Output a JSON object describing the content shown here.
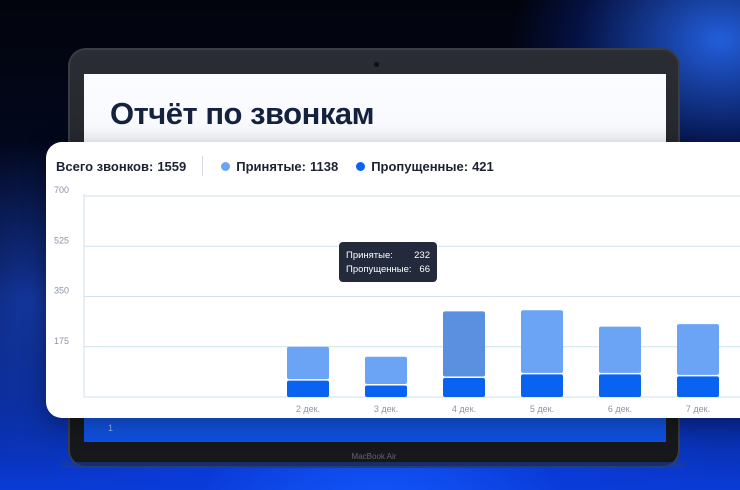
{
  "screen": {
    "title": "Отчёт по звонкам",
    "bottom_tick": "1",
    "device_label": "MacBook Air"
  },
  "summary": {
    "total_label": "Всего звонков:",
    "total_value": "1559",
    "accepted_label": "Принятые:",
    "accepted_value": "1138",
    "missed_label": "Пропущенные:",
    "missed_value": "421"
  },
  "colors": {
    "accepted": "#6ba4f5",
    "accepted_active": "#5b8fe0",
    "missed": "#0a63f0",
    "grid": "#cfe2ee",
    "tick": "#8a93a6"
  },
  "tooltip": {
    "accepted_label": "Принятые:",
    "accepted_value": "232",
    "missed_label": "Пропущенные:",
    "missed_value": "66"
  },
  "chart_data": {
    "type": "bar",
    "stacked": true,
    "title": "",
    "xlabel": "",
    "ylabel": "",
    "ylim": [
      0,
      700
    ],
    "yticks": [
      "700",
      "525",
      "350",
      "175"
    ],
    "categories": [
      "",
      "",
      "2 дек.",
      "3 дек.",
      "4 дек.",
      "5 дек.",
      "6 дек.",
      "7 дек."
    ],
    "series": [
      {
        "name": "Пропущенные",
        "values": [
          0,
          0,
          57,
          40,
          66,
          79,
          79,
          72
        ]
      },
      {
        "name": "Принятые",
        "values": [
          0,
          0,
          118,
          100,
          232,
          223,
          166,
          182
        ]
      }
    ],
    "highlighted_category": "4 дек.",
    "grid": true,
    "legend": "top-left"
  }
}
